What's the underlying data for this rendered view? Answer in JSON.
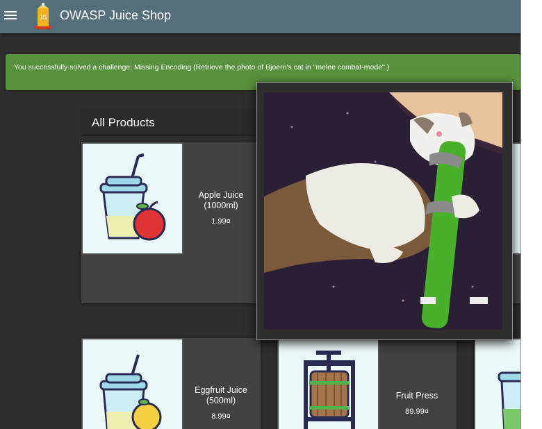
{
  "app": {
    "title": "OWASP Juice Shop"
  },
  "notification": {
    "text": "You successfully solved a challenge: Missing Encoding (Retrieve the photo of Bjoern's cat in \"melee combat-mode\".)"
  },
  "section": {
    "title": "All Products"
  },
  "products": [
    {
      "name": "Apple Juice (1000ml)",
      "price": "1.99¤",
      "fruit": "apple"
    },
    {
      "name": "Eggfruit Juice (500ml)",
      "price": "8.99¤",
      "fruit": "eggfruit"
    },
    {
      "name": "Fruit Press",
      "price": "89.99¤",
      "fruit": "press"
    }
  ],
  "colors": {
    "toolbar": "#546e7a",
    "notification": "#58913d",
    "background": "#2e2e2e",
    "card": "#424242"
  },
  "icons": [
    "menu-icon",
    "juice-shop-logo-icon",
    "cat-photo"
  ]
}
